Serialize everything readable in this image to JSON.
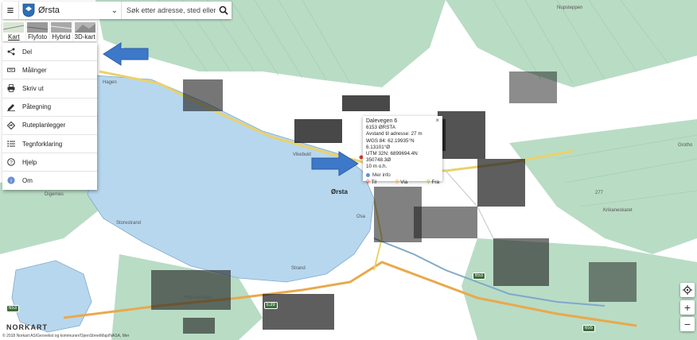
{
  "header": {
    "municipality": "Ørsta",
    "search_placeholder": "Søk etter adresse, sted eller eiendom."
  },
  "layers": {
    "tabs": [
      {
        "label": "Kart"
      },
      {
        "label": "Flyfoto"
      },
      {
        "label": "Hybrid"
      },
      {
        "label": "3D-kart"
      }
    ]
  },
  "menu": {
    "items": [
      {
        "label": "Del",
        "icon": "share-icon"
      },
      {
        "label": "Målinger",
        "icon": "ruler-icon"
      },
      {
        "label": "Skriv ut",
        "icon": "print-icon"
      },
      {
        "label": "Påtegning",
        "icon": "draw-icon"
      },
      {
        "label": "Ruteplanlegger",
        "icon": "route-icon"
      },
      {
        "label": "Tegnforklaring",
        "icon": "legend-icon"
      },
      {
        "label": "Hjelp",
        "icon": "help-icon"
      },
      {
        "label": "Om",
        "icon": "info-icon"
      }
    ]
  },
  "popup": {
    "title": "Dalevegen 6",
    "postal": "6153 ØRSTA",
    "distance": "Avstand til adresse: 27 m",
    "wgs": "WGS 84: 62.19935°N  6.13101°Ø",
    "utm": "UTM 32N: 6899694.4N  350748.3Ø",
    "height": "10 m o.h.",
    "more": "Mer info",
    "to": "Til",
    "via": "Via",
    "from": "Fra",
    "close": "×"
  },
  "map": {
    "town": "Ørsta",
    "labels": {
      "digernes": "Digernes",
      "hagen": "Hagen",
      "vikebukt": "Vikebukt",
      "storestrand": "Storestrand",
      "strand": "Strand",
      "osa": "Osa",
      "hovden": "Hovden",
      "grotho": "Grotho",
      "nupsteppen": "Nupsteppen",
      "v277": "277",
      "krikaneskaret": "Krikaneskaret",
      "ytreaurstein": "Ytre-Aurstein"
    },
    "routes": {
      "r653": "653",
      "r655": "655",
      "e39": "E39"
    }
  },
  "controls": {
    "zoom_in": "+",
    "zoom_out": "−"
  },
  "footer": {
    "logo": "NORKART",
    "copyright": "© 2018 Norkart AS/Geovekst og kommuner/OpenStreetMap/NASA, Mer"
  },
  "colors": {
    "water": "#b7d7ef",
    "land": "#ffffff",
    "forest": "#b9dcc5",
    "accent_arrow": "#3d78c9"
  }
}
